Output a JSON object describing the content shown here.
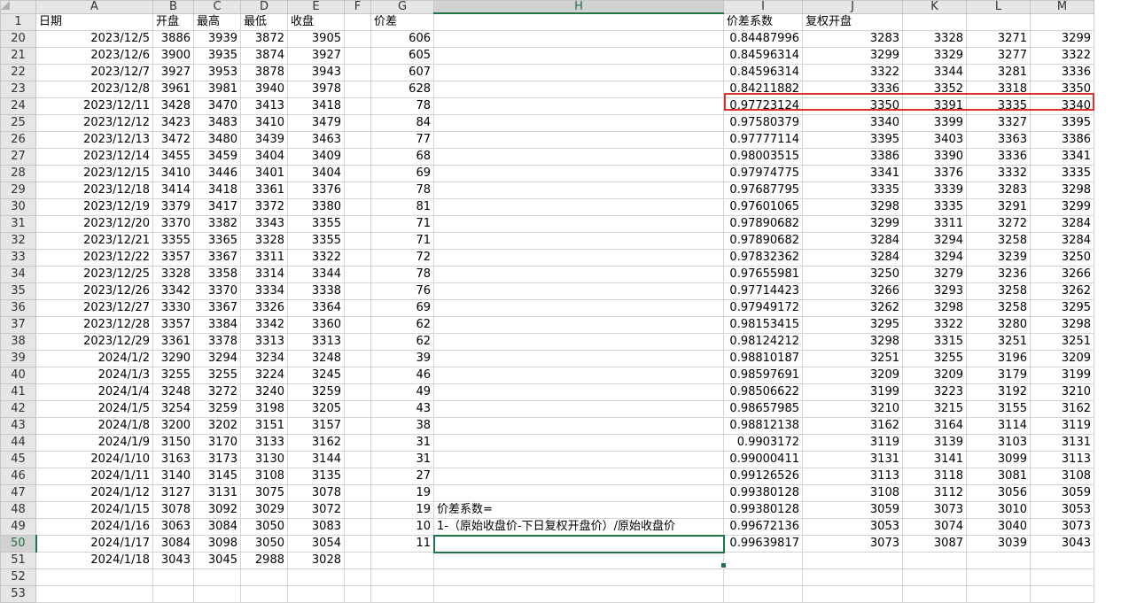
{
  "columns": [
    "A",
    "B",
    "C",
    "D",
    "E",
    "F",
    "G",
    "H",
    "I",
    "J",
    "K",
    "L",
    "M"
  ],
  "header_row": {
    "number": "1",
    "A": "日期",
    "B": "开盘",
    "C": "最高",
    "D": "最低",
    "E": "收盘",
    "F": "",
    "G": "价差",
    "H": "",
    "I": "价差系数",
    "J": "复权开盘",
    "K": "",
    "L": "",
    "M": ""
  },
  "rows": [
    {
      "n": "20",
      "A": "2023/12/5",
      "B": "3886",
      "C": "3939",
      "D": "3872",
      "E": "3905",
      "G": "606",
      "H": "",
      "I": "0.84487996",
      "J": "3283",
      "K": "3328",
      "L": "3271",
      "M": "3299"
    },
    {
      "n": "21",
      "A": "2023/12/6",
      "B": "3900",
      "C": "3935",
      "D": "3874",
      "E": "3927",
      "G": "605",
      "H": "",
      "I": "0.84596314",
      "J": "3299",
      "K": "3329",
      "L": "3277",
      "M": "3322"
    },
    {
      "n": "22",
      "A": "2023/12/7",
      "B": "3927",
      "C": "3953",
      "D": "3878",
      "E": "3943",
      "G": "607",
      "H": "",
      "I": "0.84596314",
      "J": "3322",
      "K": "3344",
      "L": "3281",
      "M": "3336"
    },
    {
      "n": "23",
      "A": "2023/12/8",
      "B": "3961",
      "C": "3981",
      "D": "3940",
      "E": "3978",
      "G": "628",
      "H": "",
      "I": "0.84211882",
      "J": "3336",
      "K": "3352",
      "L": "3318",
      "M": "3350"
    },
    {
      "n": "24",
      "A": "2023/12/11",
      "B": "3428",
      "C": "3470",
      "D": "3413",
      "E": "3418",
      "G": "78",
      "H": "",
      "I": "0.97723124",
      "J": "3350",
      "K": "3391",
      "L": "3335",
      "M": "3340"
    },
    {
      "n": "25",
      "A": "2023/12/12",
      "B": "3423",
      "C": "3483",
      "D": "3410",
      "E": "3479",
      "G": "84",
      "H": "",
      "I": "0.97580379",
      "J": "3340",
      "K": "3399",
      "L": "3327",
      "M": "3395"
    },
    {
      "n": "26",
      "A": "2023/12/13",
      "B": "3472",
      "C": "3480",
      "D": "3439",
      "E": "3463",
      "G": "77",
      "H": "",
      "I": "0.97777114",
      "J": "3395",
      "K": "3403",
      "L": "3363",
      "M": "3386"
    },
    {
      "n": "27",
      "A": "2023/12/14",
      "B": "3455",
      "C": "3459",
      "D": "3404",
      "E": "3409",
      "G": "68",
      "H": "",
      "I": "0.98003515",
      "J": "3386",
      "K": "3390",
      "L": "3336",
      "M": "3341"
    },
    {
      "n": "28",
      "A": "2023/12/15",
      "B": "3410",
      "C": "3446",
      "D": "3401",
      "E": "3404",
      "G": "69",
      "H": "",
      "I": "0.97974775",
      "J": "3341",
      "K": "3376",
      "L": "3332",
      "M": "3335"
    },
    {
      "n": "29",
      "A": "2023/12/18",
      "B": "3414",
      "C": "3418",
      "D": "3361",
      "E": "3376",
      "G": "78",
      "H": "",
      "I": "0.97687795",
      "J": "3335",
      "K": "3339",
      "L": "3283",
      "M": "3298"
    },
    {
      "n": "30",
      "A": "2023/12/19",
      "B": "3379",
      "C": "3417",
      "D": "3372",
      "E": "3380",
      "G": "81",
      "H": "",
      "I": "0.97601065",
      "J": "3298",
      "K": "3335",
      "L": "3291",
      "M": "3299"
    },
    {
      "n": "31",
      "A": "2023/12/20",
      "B": "3370",
      "C": "3382",
      "D": "3343",
      "E": "3355",
      "G": "71",
      "H": "",
      "I": "0.97890682",
      "J": "3299",
      "K": "3311",
      "L": "3272",
      "M": "3284"
    },
    {
      "n": "32",
      "A": "2023/12/21",
      "B": "3355",
      "C": "3365",
      "D": "3328",
      "E": "3355",
      "G": "71",
      "H": "",
      "I": "0.97890682",
      "J": "3284",
      "K": "3294",
      "L": "3258",
      "M": "3284"
    },
    {
      "n": "33",
      "A": "2023/12/22",
      "B": "3357",
      "C": "3367",
      "D": "3311",
      "E": "3322",
      "G": "72",
      "H": "",
      "I": "0.97832362",
      "J": "3284",
      "K": "3294",
      "L": "3239",
      "M": "3250"
    },
    {
      "n": "34",
      "A": "2023/12/25",
      "B": "3328",
      "C": "3358",
      "D": "3314",
      "E": "3344",
      "G": "78",
      "H": "",
      "I": "0.97655981",
      "J": "3250",
      "K": "3279",
      "L": "3236",
      "M": "3266"
    },
    {
      "n": "35",
      "A": "2023/12/26",
      "B": "3342",
      "C": "3370",
      "D": "3334",
      "E": "3338",
      "G": "76",
      "H": "",
      "I": "0.97714423",
      "J": "3266",
      "K": "3293",
      "L": "3258",
      "M": "3262"
    },
    {
      "n": "36",
      "A": "2023/12/27",
      "B": "3330",
      "C": "3367",
      "D": "3326",
      "E": "3364",
      "G": "69",
      "H": "",
      "I": "0.97949172",
      "J": "3262",
      "K": "3298",
      "L": "3258",
      "M": "3295"
    },
    {
      "n": "37",
      "A": "2023/12/28",
      "B": "3357",
      "C": "3384",
      "D": "3342",
      "E": "3360",
      "G": "62",
      "H": "",
      "I": "0.98153415",
      "J": "3295",
      "K": "3322",
      "L": "3280",
      "M": "3298"
    },
    {
      "n": "38",
      "A": "2023/12/29",
      "B": "3361",
      "C": "3378",
      "D": "3313",
      "E": "3313",
      "G": "62",
      "H": "",
      "I": "0.98124212",
      "J": "3298",
      "K": "3315",
      "L": "3251",
      "M": "3251"
    },
    {
      "n": "39",
      "A": "2024/1/2",
      "B": "3290",
      "C": "3294",
      "D": "3234",
      "E": "3248",
      "G": "39",
      "H": "",
      "I": "0.98810187",
      "J": "3251",
      "K": "3255",
      "L": "3196",
      "M": "3209"
    },
    {
      "n": "40",
      "A": "2024/1/3",
      "B": "3255",
      "C": "3255",
      "D": "3224",
      "E": "3245",
      "G": "46",
      "H": "",
      "I": "0.98597691",
      "J": "3209",
      "K": "3209",
      "L": "3179",
      "M": "3199"
    },
    {
      "n": "41",
      "A": "2024/1/4",
      "B": "3248",
      "C": "3272",
      "D": "3240",
      "E": "3259",
      "G": "49",
      "H": "",
      "I": "0.98506622",
      "J": "3199",
      "K": "3223",
      "L": "3192",
      "M": "3210"
    },
    {
      "n": "42",
      "A": "2024/1/5",
      "B": "3254",
      "C": "3259",
      "D": "3198",
      "E": "3205",
      "G": "43",
      "H": "",
      "I": "0.98657985",
      "J": "3210",
      "K": "3215",
      "L": "3155",
      "M": "3162"
    },
    {
      "n": "43",
      "A": "2024/1/8",
      "B": "3200",
      "C": "3202",
      "D": "3151",
      "E": "3157",
      "G": "38",
      "H": "",
      "I": "0.98812138",
      "J": "3162",
      "K": "3164",
      "L": "3114",
      "M": "3119"
    },
    {
      "n": "44",
      "A": "2024/1/9",
      "B": "3150",
      "C": "3170",
      "D": "3133",
      "E": "3162",
      "G": "31",
      "H": "",
      "I": "0.9903172",
      "J": "3119",
      "K": "3139",
      "L": "3103",
      "M": "3131"
    },
    {
      "n": "45",
      "A": "2024/1/10",
      "B": "3163",
      "C": "3173",
      "D": "3130",
      "E": "3144",
      "G": "31",
      "H": "",
      "I": "0.99000411",
      "J": "3131",
      "K": "3141",
      "L": "3099",
      "M": "3113"
    },
    {
      "n": "46",
      "A": "2024/1/11",
      "B": "3140",
      "C": "3145",
      "D": "3108",
      "E": "3135",
      "G": "27",
      "H": "",
      "I": "0.99126526",
      "J": "3113",
      "K": "3118",
      "L": "3081",
      "M": "3108"
    },
    {
      "n": "47",
      "A": "2024/1/12",
      "B": "3127",
      "C": "3131",
      "D": "3075",
      "E": "3078",
      "G": "19",
      "H": "",
      "I": "0.99380128",
      "J": "3108",
      "K": "3112",
      "L": "3056",
      "M": "3059"
    },
    {
      "n": "48",
      "A": "2024/1/15",
      "B": "3078",
      "C": "3092",
      "D": "3029",
      "E": "3072",
      "G": "19",
      "H": "价差系数=",
      "I": "0.99380128",
      "J": "3059",
      "K": "3073",
      "L": "3010",
      "M": "3053"
    },
    {
      "n": "49",
      "A": "2024/1/16",
      "B": "3063",
      "C": "3084",
      "D": "3050",
      "E": "3083",
      "G": "10",
      "H": "1-（原始收盘价-下日复权开盘价）/原始收盘价",
      "I": "0.99672136",
      "J": "3053",
      "K": "3074",
      "L": "3040",
      "M": "3073"
    },
    {
      "n": "50",
      "A": "2024/1/17",
      "B": "3084",
      "C": "3098",
      "D": "3050",
      "E": "3054",
      "G": "11",
      "H": "",
      "I": "0.99639817",
      "J": "3073",
      "K": "3087",
      "L": "3039",
      "M": "3043"
    },
    {
      "n": "51",
      "A": "2024/1/18",
      "B": "3043",
      "C": "3045",
      "D": "2988",
      "E": "3028",
      "G": "",
      "H": "",
      "I": "",
      "J": "",
      "K": "",
      "L": "",
      "M": ""
    },
    {
      "n": "52",
      "A": "",
      "B": "",
      "C": "",
      "D": "",
      "E": "",
      "G": "",
      "H": "",
      "I": "",
      "J": "",
      "K": "",
      "L": "",
      "M": ""
    },
    {
      "n": "53",
      "A": "",
      "B": "",
      "C": "",
      "D": "",
      "E": "",
      "G": "",
      "H": "",
      "I": "",
      "J": "",
      "K": "",
      "L": "",
      "M": ""
    }
  ],
  "active_cell": "H50",
  "highlighted_row": "23",
  "accent_color": "#217346",
  "highlight_color": "#e03030"
}
